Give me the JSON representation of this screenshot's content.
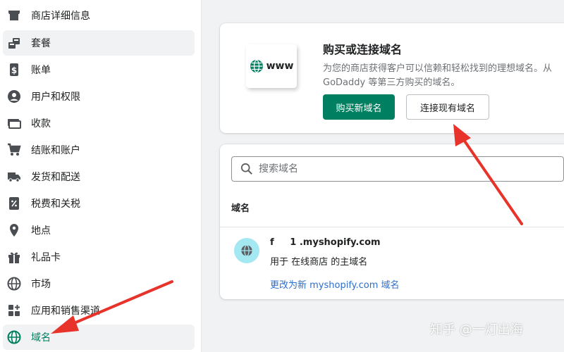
{
  "sidebar": {
    "items": [
      {
        "label": "商店详细信息",
        "icon": "store-icon"
      },
      {
        "label": "套餐",
        "icon": "plan-icon"
      },
      {
        "label": "账单",
        "icon": "dollar-icon"
      },
      {
        "label": "用户和权限",
        "icon": "user-icon"
      },
      {
        "label": "收款",
        "icon": "payment-icon"
      },
      {
        "label": "结账和账户",
        "icon": "cart-icon"
      },
      {
        "label": "发货和配送",
        "icon": "truck-icon"
      },
      {
        "label": "税费和关税",
        "icon": "tax-icon"
      },
      {
        "label": "地点",
        "icon": "location-icon"
      },
      {
        "label": "礼品卡",
        "icon": "gift-icon"
      },
      {
        "label": "市场",
        "icon": "globe-icon"
      },
      {
        "label": "应用和销售渠道",
        "icon": "apps-icon"
      },
      {
        "label": "域名",
        "icon": "domain-globe-icon"
      }
    ]
  },
  "buy_card": {
    "illustration_text": "www",
    "title": "购买或连接域名",
    "desc_line1": "为您的商店获得客户可以信赖和轻松找到的理想域名。从",
    "desc_line2": "GoDaddy 等第三方购买的域名。",
    "buy_button": "购买新域名",
    "connect_button": "连接现有域名"
  },
  "domains_card": {
    "search_placeholder": "搜索域名",
    "column_header": "域名",
    "domain": {
      "name": "f     1 .myshopify.com",
      "subtitle": "用于 在线商店 的主域名",
      "change_link": "更改为新 myshopify.com 域名"
    }
  },
  "watermark": "知乎 @一灯出海",
  "colors": {
    "primary": "#008060",
    "selected_text": "#007f5f",
    "link": "#2c6ecb",
    "arrow": "#e8332a",
    "globe_badge": "#a4e8f2"
  }
}
